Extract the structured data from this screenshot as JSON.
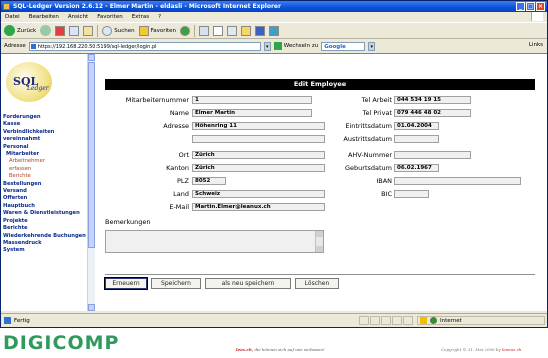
{
  "window": {
    "title": "SQL-Ledger Version 2.6.12 - Elmer Martin - eldasli - Microsoft Internet Explorer",
    "menu": [
      "Datei",
      "Bearbeiten",
      "Ansicht",
      "Favoriten",
      "Extras",
      "?"
    ]
  },
  "toolbar": {
    "back_label": "Zurück",
    "search_label": "Suchen",
    "favorites_label": "Favoriten"
  },
  "addressbar": {
    "label": "Adresse",
    "url": "https://192.168.220.50:5199/sql-ledger/login.pl",
    "go_label": "Wechseln zu",
    "google_label": "Google",
    "links_label": "Links"
  },
  "sidebar": {
    "logo_text": "SQL",
    "logo_sub": "Ledger",
    "items": [
      {
        "label": "Forderungen",
        "level": 1
      },
      {
        "label": "Kasse",
        "level": 1
      },
      {
        "label": "Verbindlichkeiten",
        "level": 1
      },
      {
        "label": "vereinnahmt",
        "level": 1
      },
      {
        "label": "Personal",
        "level": 1
      },
      {
        "label": "Mitarbeiter",
        "level": 2
      },
      {
        "label": "Arbeitnehmer",
        "level": 3
      },
      {
        "label": "erfassen",
        "level": 3
      },
      {
        "label": "Berichte",
        "level": 3
      },
      {
        "label": "Bestellungen",
        "level": 1
      },
      {
        "label": "Versand",
        "level": 1
      },
      {
        "label": "Offerten",
        "level": 1
      },
      {
        "label": "Hauptbuch",
        "level": 1
      },
      {
        "label": "Waren & Dienstleistungen",
        "level": 1
      },
      {
        "label": "Projekte",
        "level": 1
      },
      {
        "label": "Berichte",
        "level": 1
      },
      {
        "label": "Wiederkehrende Buchungen",
        "level": 1
      },
      {
        "label": "Massendruck",
        "level": 1
      },
      {
        "label": "System",
        "level": 1
      }
    ]
  },
  "form": {
    "header": "Edit Employee",
    "left": {
      "mitarbeiternummer": {
        "label": "Mitarbeiternummer",
        "value": "1"
      },
      "name": {
        "label": "Name",
        "value": "Elmer Martin"
      },
      "adresse": {
        "label": "Adresse",
        "value": "Höhenring 11"
      },
      "adresse2": {
        "value": ""
      },
      "ort": {
        "label": "Ort",
        "value": "Zürich"
      },
      "kanton": {
        "label": "Kanton",
        "value": "Zürich"
      },
      "plz": {
        "label": "PLZ",
        "value": "8052"
      },
      "land": {
        "label": "Land",
        "value": "Schweiz"
      },
      "email": {
        "label": "E-Mail",
        "value": "Martin.Elmer@leanux.ch"
      }
    },
    "right": {
      "tel_arbeit": {
        "label": "Tel Arbeit",
        "value": "044 534 19 15"
      },
      "tel_privat": {
        "label": "Tel Privat",
        "value": "079 446 48 02"
      },
      "eintrittsdatum": {
        "label": "Eintrittsdatum",
        "value": "01.04.2004"
      },
      "austrittsdatum": {
        "label": "Austrittsdatum",
        "value": ""
      },
      "ahv": {
        "label": "AHV-Nummer",
        "value": ""
      },
      "geburtsdatum": {
        "label": "Geburtsdatum",
        "value": "06.02.1967"
      },
      "iban": {
        "label": "IBAN",
        "value": ""
      },
      "bic": {
        "label": "BIC",
        "value": ""
      }
    },
    "remarks_label": "Bemerkungen",
    "remarks_value": "",
    "buttons": {
      "erneuern": "Erneuern",
      "speichern": "Speichern",
      "als_neu": "als neu speichern",
      "loeschen": "Löschen"
    }
  },
  "statusbar": {
    "status": "Fertig",
    "zone": "Internet"
  },
  "footer": {
    "logo": "DIGICOMP",
    "mid_brand": "leax.ch,",
    "mid_text": "die können sich auf uns verlassen!",
    "copyright": "Copyright © 31. Mai 2006 by",
    "copyright_brand": "leanux.ch"
  }
}
